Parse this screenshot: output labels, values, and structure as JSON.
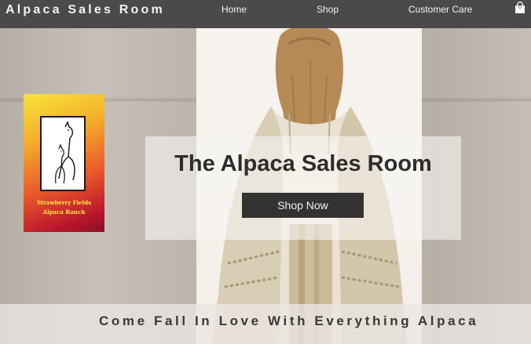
{
  "header": {
    "brand": "Alpaca Sales Room",
    "nav": [
      {
        "label": "Home"
      },
      {
        "label": "Shop"
      },
      {
        "label": "Customer Care"
      }
    ],
    "cart_count": "0",
    "cart_icon": "shopping-bag-icon",
    "background_color": "#4b4949"
  },
  "hero": {
    "title": "The Alpaca Sales Room",
    "button_label": "Shop Now",
    "tagline": "Come Fall In Love With Everything Alpaca"
  },
  "logo": {
    "line1": "Strawberry Fields",
    "line2": "Alpaca Ranch",
    "text_color": "#ffe84a"
  }
}
